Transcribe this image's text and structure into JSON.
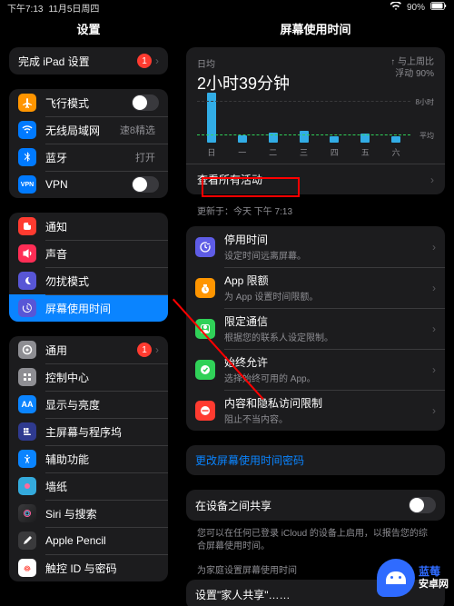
{
  "status": {
    "time": "下午7:13",
    "date": "11月5日周四",
    "battery": "90%"
  },
  "headers": {
    "left": "设置",
    "right": "屏幕使用时间"
  },
  "sidebar": {
    "setup": {
      "label": "完成 iPad 设置",
      "badge": "1"
    },
    "group1": [
      {
        "icon": "airplane-icon",
        "color": "#ff9500",
        "label": "飞行模式",
        "toggle": false
      },
      {
        "icon": "wifi-icon",
        "color": "#007aff",
        "label": "无线局域网",
        "detail": "速8精选"
      },
      {
        "icon": "bluetooth-icon",
        "color": "#007aff",
        "label": "蓝牙",
        "detail": "打开"
      },
      {
        "icon": "vpn-icon",
        "color": "#007aff",
        "label": "VPN",
        "text": "VPN",
        "toggle": false
      }
    ],
    "group2": [
      {
        "icon": "notifications-icon",
        "color": "#ff3b30",
        "label": "通知"
      },
      {
        "icon": "sound-icon",
        "color": "#ff2d55",
        "label": "声音"
      },
      {
        "icon": "dnd-icon",
        "color": "#5856d6",
        "label": "勿扰模式"
      },
      {
        "icon": "screentime-icon",
        "color": "#5856d6",
        "label": "屏幕使用时间",
        "selected": true
      }
    ],
    "group3": [
      {
        "icon": "general-icon",
        "color": "#8e8e93",
        "label": "通用",
        "badge": "1"
      },
      {
        "icon": "control-center-icon",
        "color": "#8e8e93",
        "label": "控制中心"
      },
      {
        "icon": "display-icon",
        "color": "#0a84ff",
        "label": "显示与亮度",
        "text": "AA"
      },
      {
        "icon": "homescreen-icon",
        "color": "#2f3a8f",
        "label": "主屏幕与程序坞"
      },
      {
        "icon": "accessibility-icon",
        "color": "#0a84ff",
        "label": "辅助功能"
      },
      {
        "icon": "wallpaper-icon",
        "color": "#34aadc",
        "label": "墙纸"
      },
      {
        "icon": "siri-icon",
        "color": "#1c1c1e",
        "label": "Siri 与搜索"
      },
      {
        "icon": "pencil-icon",
        "color": "#1c1c1e",
        "label": "Apple Pencil"
      },
      {
        "icon": "touchid-icon",
        "color": "#ff3b30",
        "label": "触控 ID 与密码"
      }
    ]
  },
  "chart_data": {
    "type": "bar",
    "avg_label": "日均",
    "avg_value": "2小时39分钟",
    "delta_prefix": "与上周比",
    "delta_value": "浮动 90%",
    "ylabel_top": "8小时",
    "ylabel_mid": "平均",
    "categories": [
      "日",
      "一",
      "二",
      "三",
      "四",
      "五",
      "六"
    ],
    "values": [
      7.8,
      1.2,
      1.6,
      1.8,
      1.0,
      1.4,
      1.0
    ],
    "avg_line": 2.65,
    "ymax": 8
  },
  "chart_footer": {
    "view_all": "查看所有活动",
    "updated": "更新于：今天 下午 7:13"
  },
  "features": [
    {
      "icon": "downtime-icon",
      "color": "#5e5ce6",
      "title": "停用时间",
      "sub": "设定时间远离屏幕。"
    },
    {
      "icon": "applimits-icon",
      "color": "#ff9500",
      "title": "App 限额",
      "sub": "为 App 设置时间限额。"
    },
    {
      "icon": "communication-icon",
      "color": "#30d158",
      "title": "限定通信",
      "sub": "根据您的联系人设定限制。"
    },
    {
      "icon": "always-allow-icon",
      "color": "#30d158",
      "title": "始终允许",
      "sub": "选择始终可用的 App。"
    },
    {
      "icon": "restrictions-icon",
      "color": "#ff3b30",
      "title": "内容和隐私访问限制",
      "sub": "阻止不当内容。"
    }
  ],
  "links": {
    "change_passcode": "更改屏幕使用时间密码"
  },
  "share": {
    "title": "在设备之间共享",
    "note": "您可以在任何已登录 iCloud 的设备上启用，以报告您的综合屏幕使用时间。"
  },
  "family": {
    "header": "为家庭设置屏幕使用时间",
    "row": "设置\"家人共享\"……"
  },
  "watermark": {
    "line1": "蓝莓",
    "line2": "安卓网"
  }
}
